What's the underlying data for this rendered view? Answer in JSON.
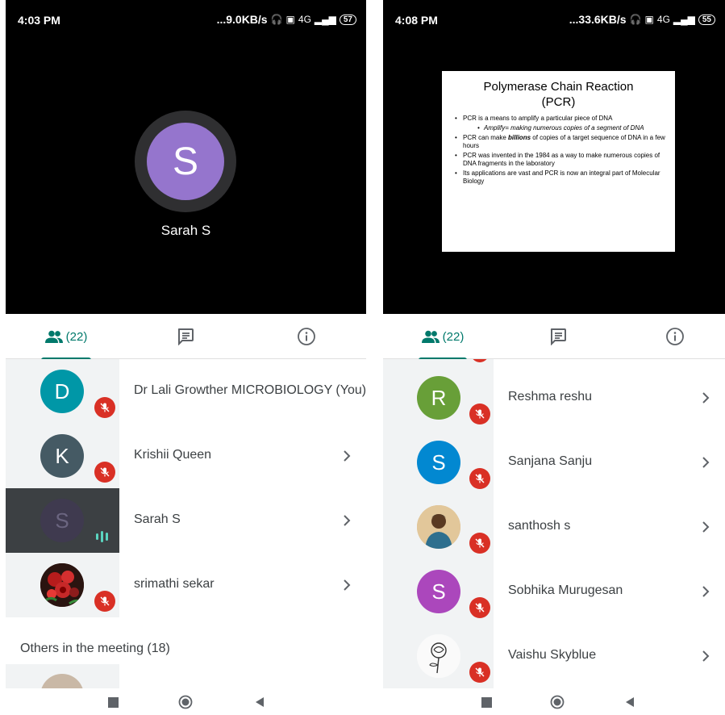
{
  "left": {
    "status": {
      "time": "4:03 PM",
      "speed": "...9.0KB/s",
      "net": "4G",
      "battery": "57"
    },
    "tile": {
      "initial": "S",
      "name": "Sarah S"
    },
    "tabs": {
      "people_count": "(22)"
    },
    "participants": [
      {
        "initial": "D",
        "name": "Dr Lali Growther MICROBIOLOGY (You)",
        "color": "#0097a7",
        "muted": true,
        "chevron": false
      },
      {
        "initial": "K",
        "name": "Krishii Queen",
        "color": "#455a64",
        "muted": true,
        "chevron": true
      },
      {
        "initial": "S",
        "name": "Sarah S",
        "color": "#3f3a4f",
        "muted": false,
        "speaking": true,
        "chevron": true
      },
      {
        "initial": "",
        "name": "srimathi sekar",
        "photo": "roses",
        "muted": true,
        "chevron": true
      }
    ],
    "others_label": "Others in the meeting (18)"
  },
  "right": {
    "status": {
      "time": "4:08 PM",
      "speed": "...33.6KB/s",
      "net": "4G",
      "battery": "55"
    },
    "slide": {
      "title_line1": "Polymerase Chain Reaction",
      "title_line2": "(PCR)",
      "bullet1": "PCR is a means to amplify a particular piece of DNA",
      "sub1": "Amplify= making numerous copies of a segment of DNA",
      "bullet2": "PCR can make billions of copies of a target sequence of DNA in a few hours",
      "bullet3": "PCR was invented in the 1984 as a way to make numerous copies of DNA fragments in the laboratory",
      "bullet4": "Its applications are vast and PCR is now an integral part of Molecular Biology"
    },
    "tabs": {
      "people_count": "(22)"
    },
    "participants": [
      {
        "initial": "R",
        "name": "Reshma reshu",
        "color": "#689f38"
      },
      {
        "initial": "S",
        "name": "Sanjana Sanju",
        "color": "#0288d1"
      },
      {
        "initial": "",
        "name": "santhosh s",
        "photo": "person"
      },
      {
        "initial": "S",
        "name": "Sobhika Murugesan",
        "color": "#ab47bc"
      },
      {
        "initial": "",
        "name": "Vaishu Skyblue",
        "photo": "rose-sketch"
      }
    ]
  },
  "colors": {
    "accent": "#00796b",
    "muted_badge": "#d93025",
    "speaking": "#5bd5c0"
  }
}
